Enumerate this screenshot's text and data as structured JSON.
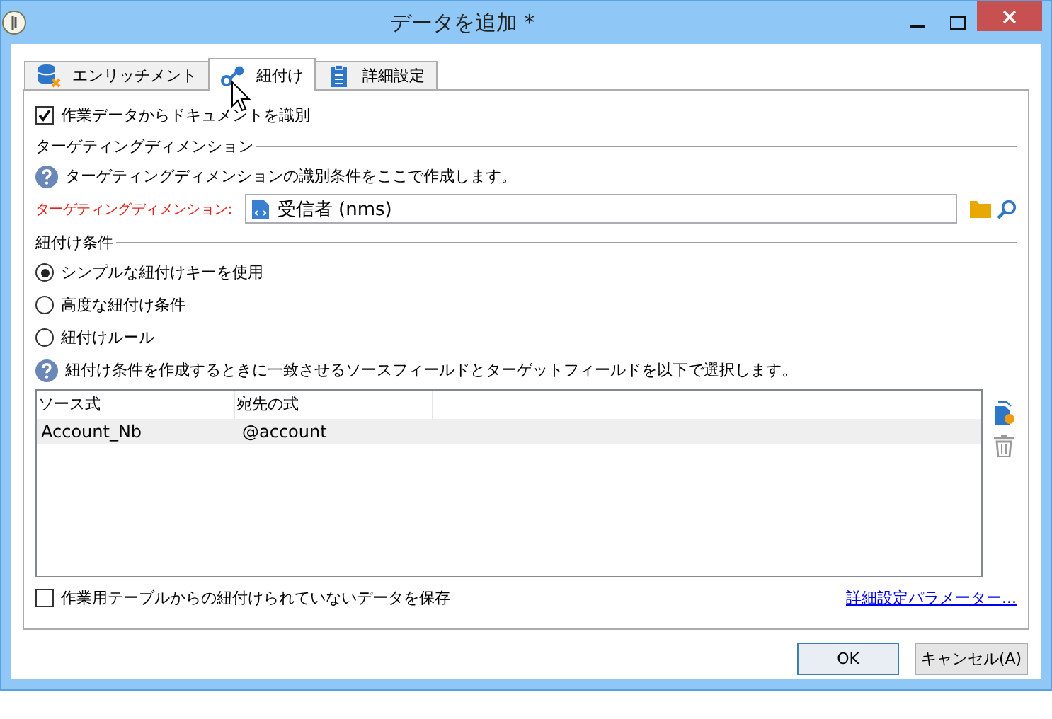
{
  "window": {
    "title": "データを追加 *"
  },
  "tabs": [
    {
      "label": "エンリッチメント",
      "selected": false,
      "kind": "db"
    },
    {
      "label": "紐付け",
      "selected": true,
      "kind": "link"
    },
    {
      "label": "詳細設定",
      "selected": false,
      "kind": "clipboard"
    }
  ],
  "identify_checkbox": {
    "label": "作業データからドキュメントを識別",
    "checked": true
  },
  "targeting_section": {
    "title": "ターゲティングディメンション",
    "info": "ターゲティングディメンションの識別条件をここで作成します。",
    "field_label": "ターゲティングディメンション:",
    "field_value": "受信者 (nms)"
  },
  "reconciliation_section": {
    "title": "紐付け条件",
    "options": [
      {
        "label": "シンプルな紐付けキーを使用",
        "selected": true
      },
      {
        "label": "高度な紐付け条件",
        "selected": false
      },
      {
        "label": "紐付けルール",
        "selected": false
      }
    ],
    "info": "紐付け条件を作成するときに一致させるソースフィールドとターゲットフィールドを以下で選択します。"
  },
  "table": {
    "columns": [
      "ソース式",
      "宛先の式"
    ],
    "rows": [
      {
        "cells": [
          "Account_Nb",
          "@account"
        ],
        "selected": true
      }
    ]
  },
  "keep_checkbox": {
    "label": "作業用テーブルからの紐付けられていないデータを保存",
    "checked": false
  },
  "advanced_link": "詳細設定パラメーター...",
  "buttons": [
    {
      "label": "OK",
      "default": true
    },
    {
      "label": "キャンセル(A)",
      "default": false
    }
  ]
}
